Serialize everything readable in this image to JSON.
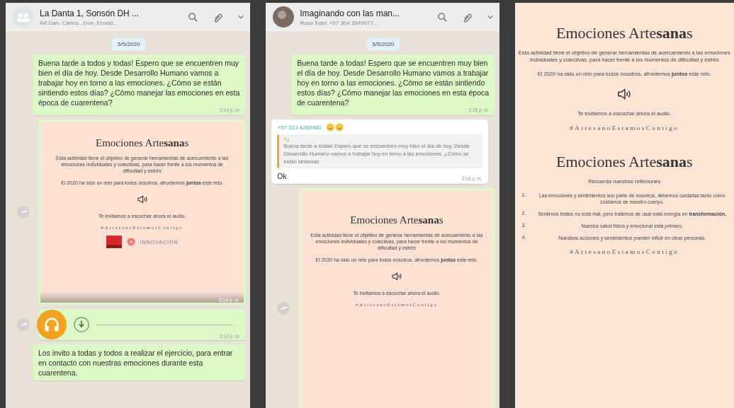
{
  "panels": [
    {
      "header": {
        "title": "La Danta 1, Sonsón DH ...",
        "subtitle": "Art Dan, Carlos , Don, Ernest..."
      },
      "items": [
        {
          "kind": "date",
          "text": "5/5/2020"
        },
        {
          "kind": "text",
          "outgoing": true,
          "text": "Buena tarde a todos y todas! Espero que se encuentren muy bien el día de hoy. Desde Desarrollo Humano vamos a trabajar hoy en torno a las emociones. ¿Cómo se están sintiendo estos días? ¿Cómo manejar las emociones en esta época de cuarentena?",
          "time": "2:14 p. m."
        },
        {
          "kind": "poster",
          "time": "2:14 p. m.",
          "blocks": [
            {
              "kind": "title",
              "text": "Emociones Arte**sana**s"
            },
            {
              "kind": "para",
              "text": "Esta actividad tiene el objetivo de generar herramientas de acercamiento a las emociones individuales y colectivas, para hacer frente a los momentos de dificultad y estrés"
            },
            {
              "kind": "para",
              "text": "El 2020 ha sido un reto para todos nosotros, afrontemos **juntos** este reto."
            },
            {
              "kind": "audio-icon"
            },
            {
              "kind": "para",
              "text": "Te invitamos a escuchar ahora el audio."
            },
            {
              "kind": "hashtag",
              "text": "#ArtesanoEstamosContigo"
            },
            {
              "kind": "logos",
              "text": "INNOVACIÓN"
            }
          ]
        },
        {
          "kind": "audio",
          "time": "2:14 p. m."
        },
        {
          "kind": "text",
          "outgoing": true,
          "text": "Los invito a todas y todos a realizar el ejercicio, para entrar en contacto con nuestras emociones durante esta cuarentena."
        }
      ]
    },
    {
      "header": {
        "title": "Imaginando con las man...",
        "subtitle": "Rosa Edid: +57 304 3649677..."
      },
      "items": [
        {
          "kind": "date",
          "text": "5/5/2020"
        },
        {
          "kind": "text",
          "outgoing": true,
          "text": "Buena tarde a todas! Espero que se encuentren muy bien el día de hoy. Desde Desarrollo Humano vamos a trabajar hoy en torno a las emociones. ¿Cómo se están sintiendo estos días? ¿Cómo manejar las emociones en esta época de cuarentena?",
          "time": "2:15 p. m."
        },
        {
          "kind": "reply",
          "sender": "+57 313 4260480",
          "quote_author": "Tú",
          "quote": "Buena tarde a todas! Espero que se encuentren muy bien el día de hoy. Desde Desarrollo Humano vamos a trabajar hoy en torno a las emociones. ¿Cómo se están sintiendo",
          "text": "Ok",
          "time": "2:16 p. m."
        },
        {
          "kind": "poster",
          "blocks": [
            {
              "kind": "title",
              "text": "Emociones Arte**sana**s"
            },
            {
              "kind": "para",
              "text": "Esta actividad tiene el objetivo de generar herramientas de acercamiento a las emociones individuales y colectivas, para hacer frente a los momentos de dificultad y estrés"
            },
            {
              "kind": "para",
              "text": "El 2020 ha sido un reto para todos nosotros, afrontemos **juntos** este reto."
            },
            {
              "kind": "audio-icon"
            },
            {
              "kind": "para",
              "text": "Te invitamos a escuchar ahora el audio."
            },
            {
              "kind": "hashtag",
              "text": "#ArtesanoEstamosContigo"
            }
          ]
        }
      ]
    },
    {
      "items": [
        {
          "kind": "poster",
          "blocks": [
            {
              "kind": "title",
              "text": "Emociones Arte**sana**s"
            },
            {
              "kind": "para",
              "text": "Esta actividad tiene el objetivo de generar herramientas de acercamiento a las emociones individuales y colectivas, para hacer frente a los momentos de dificultad y estrés"
            },
            {
              "kind": "para",
              "text": "El 2020 ha sido un reto para todos nosotros, afrontemos **juntos** este reto."
            },
            {
              "kind": "audio-icon"
            },
            {
              "kind": "para",
              "text": "Te invitamos a escuchar ahora el audio."
            },
            {
              "kind": "hashtag",
              "text": "#ArtesanoEstamosContigo"
            }
          ]
        },
        {
          "kind": "poster",
          "blocks": [
            {
              "kind": "title",
              "text": "Emociones Arte**sana**s"
            },
            {
              "kind": "para",
              "text": "Recuerda nuestras reflexiones"
            },
            {
              "kind": "list",
              "items": [
                {
                  "number": "1.",
                  "text": "Las emociones y sentimientos son parte de nosotros, debemos cuidarlas tanto como cuidamos de nuestro cuerpo."
                },
                {
                  "number": "2.",
                  "text": "Sentirnos tristes no está mal, pero tratemos de usar esta energía en **transformación.**"
                },
                {
                  "number": "3.",
                  "text": "Nuestra salud física y emocional está primero."
                },
                {
                  "number": "4.",
                  "text": "Nuestras acciones y sentimientos pueden influir en otras personas."
                }
              ]
            },
            {
              "kind": "hashtag",
              "text": "#ArtesanoEstamosContigo"
            }
          ]
        }
      ]
    }
  ]
}
